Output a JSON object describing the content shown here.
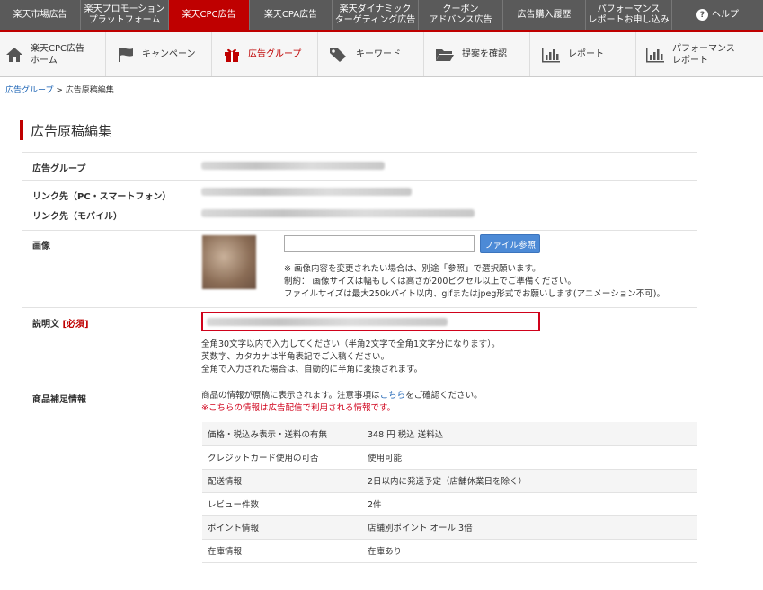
{
  "top_nav": [
    {
      "label": "楽天市場広告",
      "active": false
    },
    {
      "label": "楽天プロモーション\nプラットフォーム",
      "active": false
    },
    {
      "label": "楽天CPC広告",
      "active": true
    },
    {
      "label": "楽天CPA広告",
      "active": false
    },
    {
      "label": "楽天ダイナミック\nターゲティング広告",
      "active": false
    },
    {
      "label": "クーポン\nアドバンス広告",
      "active": false
    },
    {
      "label": "広告購入履歴",
      "active": false
    },
    {
      "label": "パフォーマンス\nレポートお申し込み",
      "active": false
    }
  ],
  "help_label": "ヘルプ",
  "sub_nav": [
    {
      "label": "楽天CPC広告\nホーム",
      "icon": "home-icon"
    },
    {
      "label": "キャンペーン",
      "icon": "flag-icon"
    },
    {
      "label": "広告グループ",
      "icon": "gift-icon",
      "active": true
    },
    {
      "label": "キーワード",
      "icon": "tag-icon"
    },
    {
      "label": "提案を確認",
      "icon": "folder-icon"
    },
    {
      "label": "レポート",
      "icon": "bar-chart-icon"
    },
    {
      "label": "パフォーマンス\nレポート",
      "icon": "bar-chart-icon"
    }
  ],
  "breadcrumb": {
    "link": "広告グループ",
    "sep": " > ",
    "current": "広告原稿編集"
  },
  "page_title": "広告原稿編集",
  "form": {
    "ad_group_label": "広告グループ",
    "link_pc_label": "リンク先（PC・スマートフォン）",
    "link_mobile_label": "リンク先（モバイル）",
    "image_label": "画像",
    "file_button": "ファイル参照",
    "image_notes": [
      "※ 画像内容を変更されたい場合は、別途「参照」で選択願います。",
      "制約： 画像サイズは幅もしくは高さが200ピクセル以上でご準備ください。",
      "ファイルサイズは最大250kバイト以内、gifまたはjpeg形式でお願いします(アニメーション不可)。"
    ],
    "description_label": "説明文",
    "required_tag": "[必須]",
    "description_notes": [
      "全角30文字以内で入力してください（半角2文字で全角1文字分になります）。",
      "英数字、カタカナは半角表記でご入稿ください。",
      "全角で入力された場合は、自動的に半角に変換されます。"
    ],
    "product_info_label": "商品補足情報",
    "product_note_prefix": "商品の情報が原稿に表示されます。注意事項は",
    "product_note_link": "こちら",
    "product_note_suffix": "をご確認ください。",
    "product_note_red": "※こちらの情報は広告配信で利用される情報です。"
  },
  "product_table": [
    [
      "価格・税込み表示・送料の有無",
      "348 円 税込 送料込"
    ],
    [
      "クレジットカード使用の可否",
      "使用可能"
    ],
    [
      "配送情報",
      "2日以内に発送予定（店舗休業日を除く）"
    ],
    [
      "レビュー件数",
      "2件"
    ],
    [
      "ポイント情報",
      "店舗別ポイント オール 3倍"
    ],
    [
      "在庫情報",
      "在庫あり"
    ]
  ],
  "colors": {
    "accent": "#bf0000",
    "nav_bg": "#5a5a5a",
    "link": "#1a62b4",
    "button": "#4c8ad6"
  }
}
